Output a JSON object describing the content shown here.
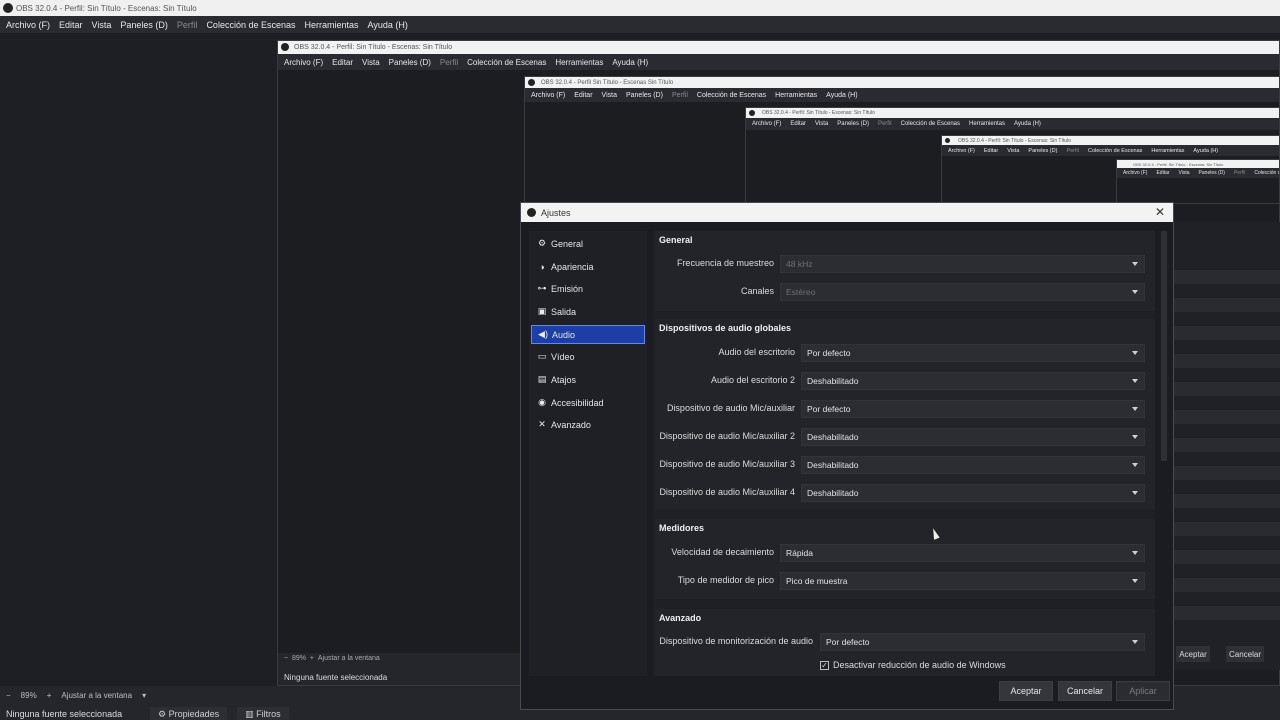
{
  "app": {
    "title": "OBS 32.0.4 - Perfil: Sin Título - Escenas: Sin Título",
    "menu": [
      "Archivo (F)",
      "Editar",
      "Vista",
      "Paneles (D)",
      "Perfil",
      "Colección de Escenas",
      "Herramientas",
      "Ayuda (H)"
    ]
  },
  "nested": {
    "title1": "OBS 32.0.4 - Perfil: Sin Título - Escenas: Sin Título",
    "title2": "OBS 32.0.4 - Perfil Sin Título - Escenas Sin Título",
    "title3": "OBS 32.0.4 - Perfil: Sin Título - Escenas: Sin Título",
    "title4": "OBS 32.0.4 - Perfil: Sin Título - Escenas: Sin Título",
    "title5": "OBS 32.0.4 - Perfil: Sin Título - Escenas: Sin Título"
  },
  "bottom": {
    "zoom": "89%",
    "fit": "Ajustar a la ventana",
    "no_source": "Ninguna fuente seleccionada",
    "properties": "Propiedades",
    "filters": "Filtros"
  },
  "dialog": {
    "title": "Ajustes",
    "sidebar": [
      {
        "label": "General",
        "icon": "gear-icon"
      },
      {
        "label": "Apariencia",
        "icon": "palette-icon"
      },
      {
        "label": "Emisión",
        "icon": "broadcast-icon"
      },
      {
        "label": "Salida",
        "icon": "output-icon"
      },
      {
        "label": "Audio",
        "icon": "speaker-icon"
      },
      {
        "label": "Vídeo",
        "icon": "monitor-icon"
      },
      {
        "label": "Atajos",
        "icon": "keyboard-icon"
      },
      {
        "label": "Accesibilidad",
        "icon": "accessibility-icon"
      },
      {
        "label": "Avanzado",
        "icon": "tools-icon"
      }
    ],
    "active_item": "Audio",
    "general": {
      "title": "General",
      "sample_rate_label": "Frecuencia de muestreo",
      "sample_rate_value": "48 kHz",
      "channels_label": "Canales",
      "channels_value": "Estéreo"
    },
    "global_devices": {
      "title": "Dispositivos de audio globales",
      "rows": [
        {
          "label": "Audio del escritorio",
          "value": "Por defecto"
        },
        {
          "label": "Audio del escritorio 2",
          "value": "Deshabilitado"
        },
        {
          "label": "Dispositivo de audio Mic/auxiliar",
          "value": "Por defecto"
        },
        {
          "label": "Dispositivo de audio Mic/auxiliar 2",
          "value": "Deshabilitado"
        },
        {
          "label": "Dispositivo de audio Mic/auxiliar 3",
          "value": "Deshabilitado"
        },
        {
          "label": "Dispositivo de audio Mic/auxiliar 4",
          "value": "Deshabilitado"
        }
      ]
    },
    "meters": {
      "title": "Medidores",
      "decay_label": "Velocidad de decaimiento",
      "decay_value": "Rápida",
      "peak_label": "Tipo de medidor de pico",
      "peak_value": "Pico de muestra"
    },
    "advanced": {
      "title": "Avanzado",
      "monitor_label": "Dispositivo de monitorización de audio",
      "monitor_value": "Por defecto",
      "ducking_label": "Desactivar reducción de audio de Windows",
      "ducking_checked": true
    },
    "buttons": {
      "accept": "Aceptar",
      "cancel": "Cancelar",
      "apply": "Aplicar"
    }
  },
  "right_buttons": {
    "accept": "Aceptar",
    "cancel": "Cancelar"
  }
}
